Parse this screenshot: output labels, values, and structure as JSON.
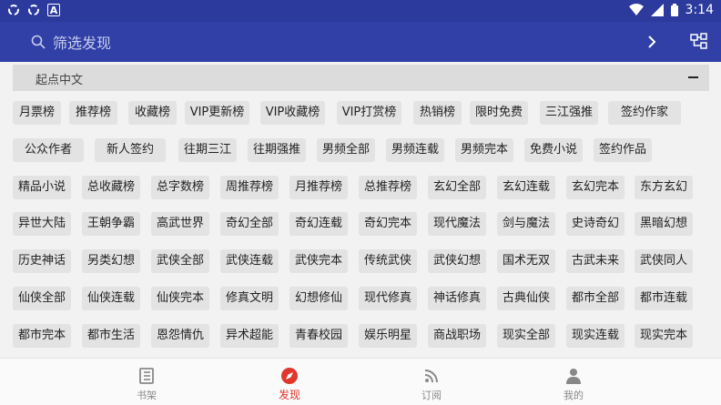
{
  "status_bar": {
    "time": "3:14"
  },
  "search": {
    "placeholder": "筛选发现"
  },
  "section": {
    "title": "起点中文"
  },
  "tag_rows": [
    [
      "月票榜",
      "推荐榜",
      "收藏榜",
      "VIP更新榜",
      "VIP收藏榜",
      "VIP打赏榜",
      "热销榜",
      "限时免费",
      "三江强推",
      "签约作家"
    ],
    [
      "公众作者",
      "新人签约",
      "往期三江",
      "往期强推",
      "男频全部",
      "男频连载",
      "男频完本",
      "免费小说",
      "签约作品"
    ],
    [
      "精品小说",
      "总收藏榜",
      "总字数榜",
      "周推荐榜",
      "月推荐榜",
      "总推荐榜",
      "玄幻全部",
      "玄幻连载",
      "玄幻完本",
      "东方玄幻"
    ],
    [
      "异世大陆",
      "王朝争霸",
      "高武世界",
      "奇幻全部",
      "奇幻连载",
      "奇幻完本",
      "现代魔法",
      "剑与魔法",
      "史诗奇幻",
      "黑暗幻想"
    ],
    [
      "历史神话",
      "另类幻想",
      "武侠全部",
      "武侠连载",
      "武侠完本",
      "传统武侠",
      "武侠幻想",
      "国术无双",
      "古武未来",
      "武侠同人"
    ],
    [
      "仙侠全部",
      "仙侠连载",
      "仙侠完本",
      "修真文明",
      "幻想修仙",
      "现代修真",
      "神话修真",
      "古典仙侠",
      "都市全部",
      "都市连载"
    ],
    [
      "都市完本",
      "都市生活",
      "恩怨情仇",
      "异术超能",
      "青春校园",
      "娱乐明星",
      "商战职场",
      "现实全部",
      "现实连载",
      "现实完本"
    ]
  ],
  "bottom_nav": [
    {
      "label": "书架",
      "icon": "bookshelf-icon",
      "active": false
    },
    {
      "label": "发现",
      "icon": "compass-icon",
      "active": true
    },
    {
      "label": "订阅",
      "icon": "rss-icon",
      "active": false
    },
    {
      "label": "我的",
      "icon": "person-icon",
      "active": false
    }
  ],
  "colors": {
    "appbar": "#3040a6",
    "statusbar": "#2b3a9c",
    "accent": "#e0362c",
    "chip_bg": "#e3e3e3"
  }
}
